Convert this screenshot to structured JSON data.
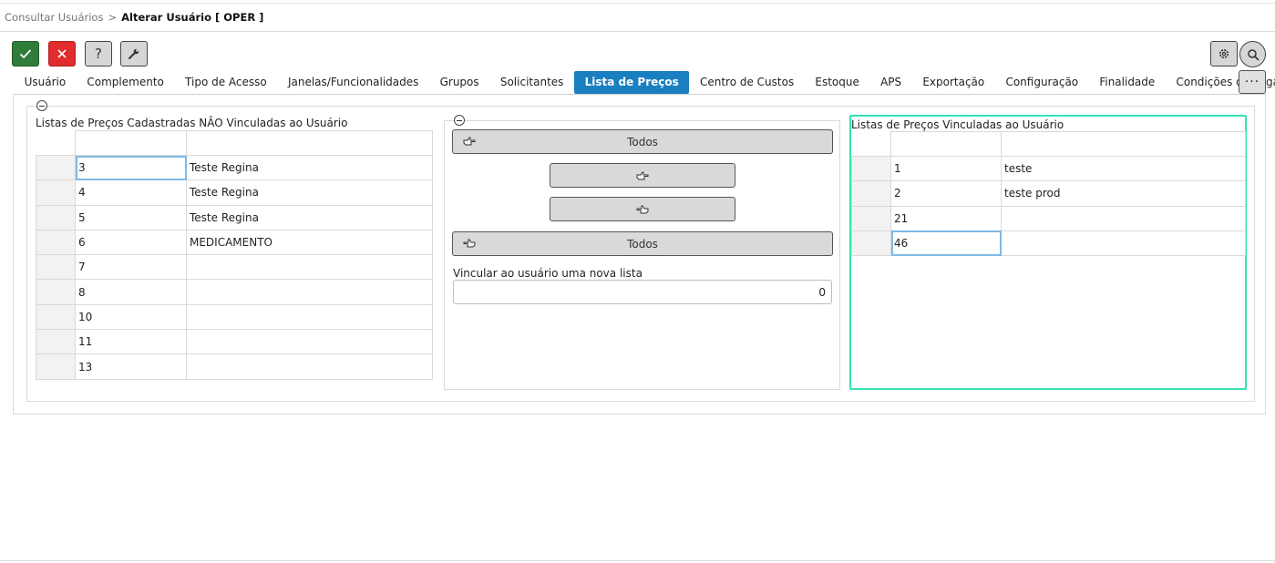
{
  "breadcrumb": {
    "parent": "Consultar Usuários",
    "separator": ">",
    "current": "Alterar Usuário [ OPER ]"
  },
  "toolbar": {
    "help_label": "?",
    "more_label": "···"
  },
  "tabs": [
    {
      "label": "Usuário"
    },
    {
      "label": "Complemento"
    },
    {
      "label": "Tipo de Acesso"
    },
    {
      "label": "Janelas/Funcionalidades"
    },
    {
      "label": "Grupos"
    },
    {
      "label": "Solicitantes"
    },
    {
      "label": "Lista de Preços",
      "active": true
    },
    {
      "label": "Centro de Custos"
    },
    {
      "label": "Estoque"
    },
    {
      "label": "APS"
    },
    {
      "label": "Exportação"
    },
    {
      "label": "Configuração"
    },
    {
      "label": "Finalidade"
    },
    {
      "label": "Condições de Pagamento"
    }
  ],
  "unlinked": {
    "title": "Listas de Preços Cadastradas NÃO Vinculadas ao Usuário",
    "rows": [
      {
        "code": "3",
        "name": "Teste Regina"
      },
      {
        "code": "4",
        "name": "Teste Regina"
      },
      {
        "code": "5",
        "name": "Teste Regina"
      },
      {
        "code": "6",
        "name": "MEDICAMENTO"
      },
      {
        "code": "7",
        "name": ""
      },
      {
        "code": "8",
        "name": ""
      },
      {
        "code": "10",
        "name": ""
      },
      {
        "code": "11",
        "name": ""
      },
      {
        "code": "13",
        "name": ""
      }
    ]
  },
  "actions": {
    "add_all_label": "Todos",
    "remove_all_label": "Todos",
    "new_list_label": "Vincular ao usuário uma nova lista",
    "new_list_value": "0"
  },
  "linked": {
    "title": "Listas de Preços Vinculadas ao Usuário",
    "rows": [
      {
        "code": "1",
        "name": "teste"
      },
      {
        "code": "2",
        "name": "teste prod"
      },
      {
        "code": "21",
        "name": ""
      },
      {
        "code": "46",
        "name": ""
      }
    ]
  },
  "colors": {
    "accent": "#1a7fc1",
    "confirm": "#2e7d3a",
    "cancel": "#e12d2d",
    "highlight": "#35e2b3"
  },
  "icons": {
    "confirm": "check-icon",
    "cancel": "close-icon",
    "help": "help-icon",
    "tools": "wrench-icon",
    "settings": "gear-icon",
    "search": "search-icon",
    "add": "pointing-hand-right-icon",
    "remove": "pointing-hand-left-icon",
    "collapse": "collapse-icon"
  }
}
